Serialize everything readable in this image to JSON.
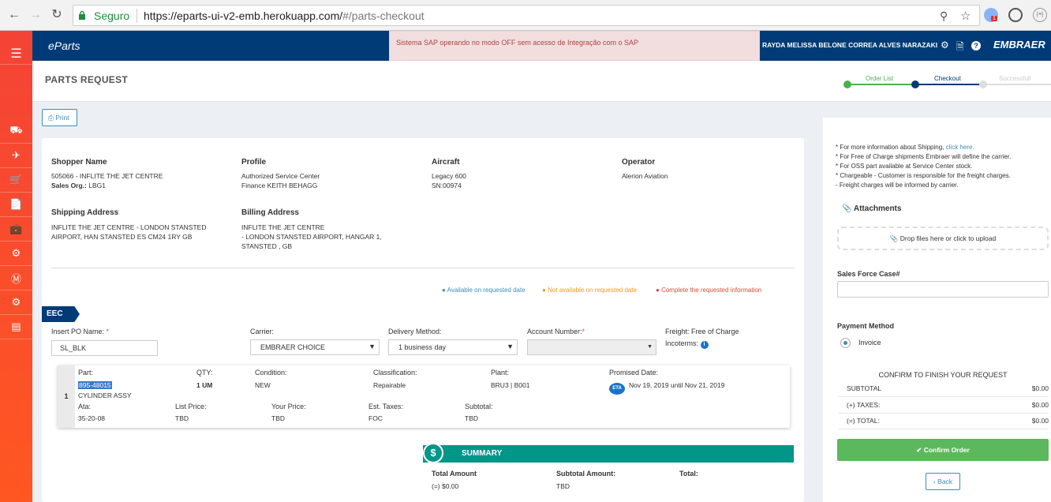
{
  "browser": {
    "secure_label": "Seguro",
    "url_host": "https://eparts-ui-v2-emb.herokuapp.com/",
    "url_path": "#/parts-checkout",
    "ext_badge": "1"
  },
  "app": {
    "logo": "eParts",
    "alert": "Sistema SAP operando no modo OFF sem acesso de Integração com o SAP",
    "user": "RAYDA MELISSA BELONE CORREA ALVES NARAZAKI",
    "brand": "EMBRAER"
  },
  "page": {
    "title": "PARTS REQUEST",
    "steps": [
      "Order List",
      "Checkout",
      "Successfull"
    ],
    "print_label": "Print"
  },
  "info": {
    "shopper_label": "Shopper Name",
    "shopper_line1": "505066 - INFLITE THE JET CENTRE",
    "sales_org_label": "Sales Org.:",
    "sales_org_value": "LBG1",
    "profile_label": "Profile",
    "profile_line1": "Authorized Service Center",
    "profile_line2": "Finance KEITH BEHAGG",
    "aircraft_label": "Aircraft",
    "aircraft_line1": "Legacy 600",
    "aircraft_line2": "SN:00974",
    "operator_label": "Operator",
    "operator_value": "Alerion Aviation",
    "shipping_label": "Shipping Address",
    "shipping_line1": "INFLITE THE JET CENTRE - LONDON STANSTED",
    "shipping_line2": "AIRPORT, HAN STANSTED ES CM24 1RY GB",
    "billing_label": "Billing Address",
    "billing_line1": "INFLITE THE JET CENTRE",
    "billing_line2": "- LONDON STANSTED AIRPORT, HANGAR 1,",
    "billing_line3": "STANSTED , GB"
  },
  "legend": {
    "available": "Available on requested date",
    "not_available": "Not available on requested date",
    "complete": "Complete the requested information",
    "colors": {
      "available": "#3c8dbc",
      "not_available": "#f39c12",
      "complete": "#dd4b39"
    }
  },
  "section": {
    "name": "EEC",
    "po_label": "Insert PO Name:",
    "po_value": "SL_BLK",
    "carrier_label": "Carrier:",
    "carrier_value": "EMBRAER CHOICE",
    "delivery_label": "Delivery Method:",
    "delivery_value": "1 business day",
    "account_label": "Account Number:",
    "freight_label": "Freight:",
    "freight_value": "Free of Charge",
    "incoterms_label": "Incoterms:"
  },
  "item": {
    "number": "1",
    "part_label": "Part:",
    "part_number": "895-48015",
    "part_desc": "CYLINDER ASSY",
    "qty_label": "QTY:",
    "qty_value": "1 UM",
    "condition_label": "Condition:",
    "condition_value": "NEW",
    "classification_label": "Classification:",
    "classification_value": "Repairable",
    "plant_label": "Plant:",
    "plant_value": "BRU3 | B001",
    "promised_label": "Promised Date:",
    "eta": "ETA",
    "promised_value": "Nov 19, 2019 until Nov 21, 2019",
    "ata_label": "Ata:",
    "ata_value": "35-20-08",
    "list_price_label": "List Price:",
    "list_price_value": "TBD",
    "your_price_label": "Your Price:",
    "your_price_value": "TBD",
    "taxes_label": "Est. Taxes:",
    "taxes_value": "FOC",
    "subtotal_label": "Subtotal:",
    "subtotal_value": "TBD"
  },
  "summary": {
    "title": "SUMMARY",
    "total_amount_label": "Total Amount",
    "total_amount_value": "(=) $0.00",
    "subtotal_label": "Subtotal Amount:",
    "subtotal_value": "TBD",
    "total_label": "Total:"
  },
  "right": {
    "note_shipping": "* For more information about Shipping,",
    "note_link": "click here.",
    "note_free": "* For Free of Charge shipments Embraer will define the carrier.",
    "note_oss": "* For OSS part available at Service Center stock.",
    "note_chargeable": "* Chargeable - Customer is responsible for the freight charges.",
    "note_freight": "- Freight charges will be informed by carrier.",
    "attachments": "Attachments",
    "drop": "Drop files here or click to upload",
    "salesforce_label": "Sales Force Case#",
    "payment_label": "Payment Method",
    "payment_option": "Invoice",
    "confirm_title": "CONFIRM TO FINISH YOUR REQUEST",
    "subtotal_label": "SUBTOTAL",
    "subtotal_value": "$0.00",
    "taxes_label": "(+) TAXES:",
    "taxes_value": "$0.00",
    "total_label": "(=) TOTAL:",
    "total_value": "$0.00",
    "confirm_button": "Confirm Order",
    "back_button": "Back"
  }
}
